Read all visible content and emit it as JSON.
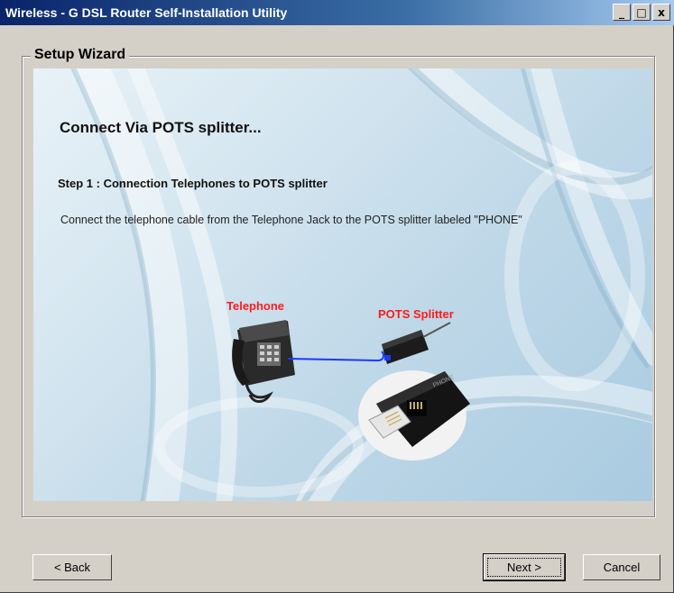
{
  "window": {
    "title": "Wireless - G DSL Router Self-Installation Utility",
    "controls": {
      "minimize": "_",
      "maximize": "□",
      "close": "x"
    }
  },
  "wizard": {
    "group_label": "Setup Wizard",
    "heading": "Connect Via POTS splitter...",
    "step_title": "Step 1 : Connection Telephones to POTS splitter",
    "description": "Connect the telephone cable from the Telephone Jack to the POTS splitter labeled \"PHONE\"",
    "labels": {
      "telephone": "Telephone",
      "pots_splitter": "POTS Splitter"
    },
    "jack_label": "PHONE"
  },
  "buttons": {
    "back": "< Back",
    "next": "Next >",
    "cancel": "Cancel"
  },
  "colors": {
    "title_bar": "#0a246a",
    "label_red": "#ff1a1a",
    "cable_blue": "#1a3aff",
    "window_face": "#d4d0c8"
  }
}
